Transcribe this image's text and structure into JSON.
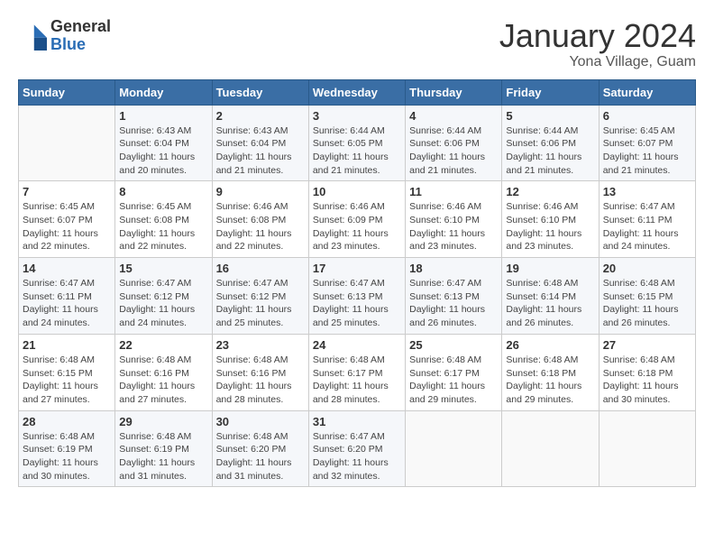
{
  "header": {
    "logo_line1": "General",
    "logo_line2": "Blue",
    "month": "January 2024",
    "location": "Yona Village, Guam"
  },
  "weekdays": [
    "Sunday",
    "Monday",
    "Tuesday",
    "Wednesday",
    "Thursday",
    "Friday",
    "Saturday"
  ],
  "weeks": [
    [
      {
        "day": "",
        "info": ""
      },
      {
        "day": "1",
        "info": "Sunrise: 6:43 AM\nSunset: 6:04 PM\nDaylight: 11 hours and 20 minutes."
      },
      {
        "day": "2",
        "info": "Sunrise: 6:43 AM\nSunset: 6:04 PM\nDaylight: 11 hours and 21 minutes."
      },
      {
        "day": "3",
        "info": "Sunrise: 6:44 AM\nSunset: 6:05 PM\nDaylight: 11 hours and 21 minutes."
      },
      {
        "day": "4",
        "info": "Sunrise: 6:44 AM\nSunset: 6:06 PM\nDaylight: 11 hours and 21 minutes."
      },
      {
        "day": "5",
        "info": "Sunrise: 6:44 AM\nSunset: 6:06 PM\nDaylight: 11 hours and 21 minutes."
      },
      {
        "day": "6",
        "info": "Sunrise: 6:45 AM\nSunset: 6:07 PM\nDaylight: 11 hours and 21 minutes."
      }
    ],
    [
      {
        "day": "7",
        "info": "Sunrise: 6:45 AM\nSunset: 6:07 PM\nDaylight: 11 hours and 22 minutes."
      },
      {
        "day": "8",
        "info": "Sunrise: 6:45 AM\nSunset: 6:08 PM\nDaylight: 11 hours and 22 minutes."
      },
      {
        "day": "9",
        "info": "Sunrise: 6:46 AM\nSunset: 6:08 PM\nDaylight: 11 hours and 22 minutes."
      },
      {
        "day": "10",
        "info": "Sunrise: 6:46 AM\nSunset: 6:09 PM\nDaylight: 11 hours and 23 minutes."
      },
      {
        "day": "11",
        "info": "Sunrise: 6:46 AM\nSunset: 6:10 PM\nDaylight: 11 hours and 23 minutes."
      },
      {
        "day": "12",
        "info": "Sunrise: 6:46 AM\nSunset: 6:10 PM\nDaylight: 11 hours and 23 minutes."
      },
      {
        "day": "13",
        "info": "Sunrise: 6:47 AM\nSunset: 6:11 PM\nDaylight: 11 hours and 24 minutes."
      }
    ],
    [
      {
        "day": "14",
        "info": "Sunrise: 6:47 AM\nSunset: 6:11 PM\nDaylight: 11 hours and 24 minutes."
      },
      {
        "day": "15",
        "info": "Sunrise: 6:47 AM\nSunset: 6:12 PM\nDaylight: 11 hours and 24 minutes."
      },
      {
        "day": "16",
        "info": "Sunrise: 6:47 AM\nSunset: 6:12 PM\nDaylight: 11 hours and 25 minutes."
      },
      {
        "day": "17",
        "info": "Sunrise: 6:47 AM\nSunset: 6:13 PM\nDaylight: 11 hours and 25 minutes."
      },
      {
        "day": "18",
        "info": "Sunrise: 6:47 AM\nSunset: 6:13 PM\nDaylight: 11 hours and 26 minutes."
      },
      {
        "day": "19",
        "info": "Sunrise: 6:48 AM\nSunset: 6:14 PM\nDaylight: 11 hours and 26 minutes."
      },
      {
        "day": "20",
        "info": "Sunrise: 6:48 AM\nSunset: 6:15 PM\nDaylight: 11 hours and 26 minutes."
      }
    ],
    [
      {
        "day": "21",
        "info": "Sunrise: 6:48 AM\nSunset: 6:15 PM\nDaylight: 11 hours and 27 minutes."
      },
      {
        "day": "22",
        "info": "Sunrise: 6:48 AM\nSunset: 6:16 PM\nDaylight: 11 hours and 27 minutes."
      },
      {
        "day": "23",
        "info": "Sunrise: 6:48 AM\nSunset: 6:16 PM\nDaylight: 11 hours and 28 minutes."
      },
      {
        "day": "24",
        "info": "Sunrise: 6:48 AM\nSunset: 6:17 PM\nDaylight: 11 hours and 28 minutes."
      },
      {
        "day": "25",
        "info": "Sunrise: 6:48 AM\nSunset: 6:17 PM\nDaylight: 11 hours and 29 minutes."
      },
      {
        "day": "26",
        "info": "Sunrise: 6:48 AM\nSunset: 6:18 PM\nDaylight: 11 hours and 29 minutes."
      },
      {
        "day": "27",
        "info": "Sunrise: 6:48 AM\nSunset: 6:18 PM\nDaylight: 11 hours and 30 minutes."
      }
    ],
    [
      {
        "day": "28",
        "info": "Sunrise: 6:48 AM\nSunset: 6:19 PM\nDaylight: 11 hours and 30 minutes."
      },
      {
        "day": "29",
        "info": "Sunrise: 6:48 AM\nSunset: 6:19 PM\nDaylight: 11 hours and 31 minutes."
      },
      {
        "day": "30",
        "info": "Sunrise: 6:48 AM\nSunset: 6:20 PM\nDaylight: 11 hours and 31 minutes."
      },
      {
        "day": "31",
        "info": "Sunrise: 6:47 AM\nSunset: 6:20 PM\nDaylight: 11 hours and 32 minutes."
      },
      {
        "day": "",
        "info": ""
      },
      {
        "day": "",
        "info": ""
      },
      {
        "day": "",
        "info": ""
      }
    ]
  ]
}
